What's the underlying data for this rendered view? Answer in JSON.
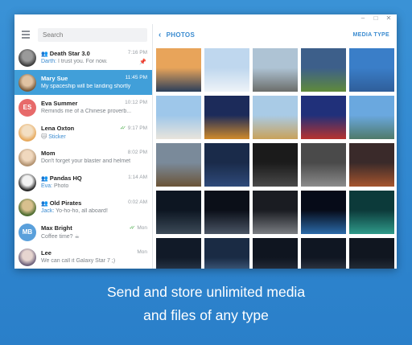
{
  "window": {
    "controls": [
      "–",
      "□",
      "✕"
    ]
  },
  "sidebar": {
    "menu_icon": "hamburger-icon",
    "search_placeholder": "Search",
    "chats": [
      {
        "name": "Death Star 3.0",
        "group": true,
        "time": "7:16 PM",
        "sender": "Darth:",
        "message": "I trust you. For now.",
        "pinned": true,
        "avatar": {
          "type": "image",
          "colors": [
            "#3b3b3b",
            "#9a9a9a"
          ]
        }
      },
      {
        "name": "Mary Sue",
        "time": "11:45 PM",
        "message": "My spaceship will be landing shortly",
        "selected": true,
        "avatar": {
          "type": "image",
          "colors": [
            "#7a5a3a",
            "#e0c2a2"
          ]
        }
      },
      {
        "name": "Eva Summer",
        "time": "10:12 PM",
        "message": "Reminds me of a Chinese proverb...",
        "avatar": {
          "type": "initials",
          "initials": "ES",
          "color": "#e76a6a"
        }
      },
      {
        "name": "Lena Oxton",
        "time": "9:17 PM",
        "read": true,
        "sticker_emoji": "🐱",
        "message": "Sticker",
        "avatar": {
          "type": "image",
          "colors": [
            "#e6a85b",
            "#f3dfc3"
          ]
        }
      },
      {
        "name": "Mom",
        "time": "8:02 PM",
        "message": "Don't forget your blaster and helmet",
        "avatar": {
          "type": "image",
          "colors": [
            "#b0906e",
            "#f0d8be"
          ]
        }
      },
      {
        "name": "Pandas HQ",
        "group": true,
        "time": "1:14 AM",
        "sender": "Eva:",
        "message": "Photo",
        "avatar": {
          "type": "image",
          "colors": [
            "#222222",
            "#f2f2f2"
          ]
        }
      },
      {
        "name": "Old Pirates",
        "group": true,
        "time": "0:02 AM",
        "sender": "Jack:",
        "message": "Yo-ho-ho, all aboard!",
        "avatar": {
          "type": "image",
          "colors": [
            "#4b6b2f",
            "#d8c08e"
          ]
        }
      },
      {
        "name": "Max Bright",
        "time": "Mon",
        "read": true,
        "message": "Coffee time? ☕",
        "avatar": {
          "type": "initials",
          "initials": "MB",
          "color": "#5aa0db"
        }
      },
      {
        "name": "Lee",
        "time": "Mon",
        "message": "We can call it Galaxy Star 7 ;)",
        "avatar": {
          "type": "image",
          "colors": [
            "#6b5f7a",
            "#e6d5d0"
          ]
        }
      }
    ]
  },
  "main": {
    "back_label": "PHOTOS",
    "media_type_label": "MEDIA TYPE",
    "photos": [
      {
        "name": "lake-sunset",
        "sky": "#e8a45a",
        "ground": "#2b3e5a"
      },
      {
        "name": "winter-tree",
        "sky": "#bfd7ee",
        "ground": "#eef3f8"
      },
      {
        "name": "rock-boulder",
        "sky": "#aec3d4",
        "ground": "#6b6d6a"
      },
      {
        "name": "green-tree-field",
        "sky": "#3d5f8a",
        "ground": "#5f8a3a"
      },
      {
        "name": "mountain-lake",
        "sky": "#3a7ec8",
        "ground": "#2f5e9a"
      },
      {
        "name": "taj-mahal",
        "sky": "#9ec7ea",
        "ground": "#e9e4dc"
      },
      {
        "name": "eiffel-tower-night",
        "sky": "#1c2b5a",
        "ground": "#d08a2a"
      },
      {
        "name": "pyramids",
        "sky": "#a9cbe6",
        "ground": "#c9a25a"
      },
      {
        "name": "st-basil-cathedral",
        "sky": "#20307a",
        "ground": "#b8322e"
      },
      {
        "name": "statue-of-liberty",
        "sky": "#6aa8df",
        "ground": "#4f7a6a"
      },
      {
        "name": "big-ben",
        "sky": "#7a8a9a",
        "ground": "#6b5437"
      },
      {
        "name": "stormtrooper-city",
        "sky": "#1a2b4a",
        "ground": "#2f4a7a"
      },
      {
        "name": "darth-vader",
        "sky": "#1b1b1b",
        "ground": "#4a4a4a"
      },
      {
        "name": "sci-fi-corridor",
        "sky": "#4a4a4a",
        "ground": "#8c8c8c"
      },
      {
        "name": "lava-battle",
        "sky": "#3a2a2a",
        "ground": "#a6552e"
      },
      {
        "name": "star-destroyer",
        "sky": "#0d1622",
        "ground": "#3c4a58"
      },
      {
        "name": "death-star-battle",
        "sky": "#0b0f18",
        "ground": "#4a5565"
      },
      {
        "name": "space-ship-planet",
        "sky": "#1a1c22",
        "ground": "#7a7d82"
      },
      {
        "name": "blue-planet",
        "sky": "#060b18",
        "ground": "#2b6aa8"
      },
      {
        "name": "green-nebula",
        "sky": "#0c3a3a",
        "ground": "#2f9a8a"
      },
      {
        "name": "space-fleet-1",
        "sky": "#111a28",
        "ground": "#3b4d64"
      },
      {
        "name": "space-hangar",
        "sky": "#1a2b44",
        "ground": "#5a7fa8"
      },
      {
        "name": "space-fleet-2",
        "sky": "#0f1520",
        "ground": "#3a4250"
      },
      {
        "name": "space-fleet-3",
        "sky": "#0f1622",
        "ground": "#4b5462"
      },
      {
        "name": "space-fleet-4",
        "sky": "#101620",
        "ground": "#38424f"
      }
    ]
  },
  "caption": {
    "line1": "Send and store unlimited media",
    "line2": "and files of any type"
  },
  "colors": {
    "accent": "#3a8bd0",
    "selected": "#419fd9",
    "background": "#3a92d6"
  }
}
